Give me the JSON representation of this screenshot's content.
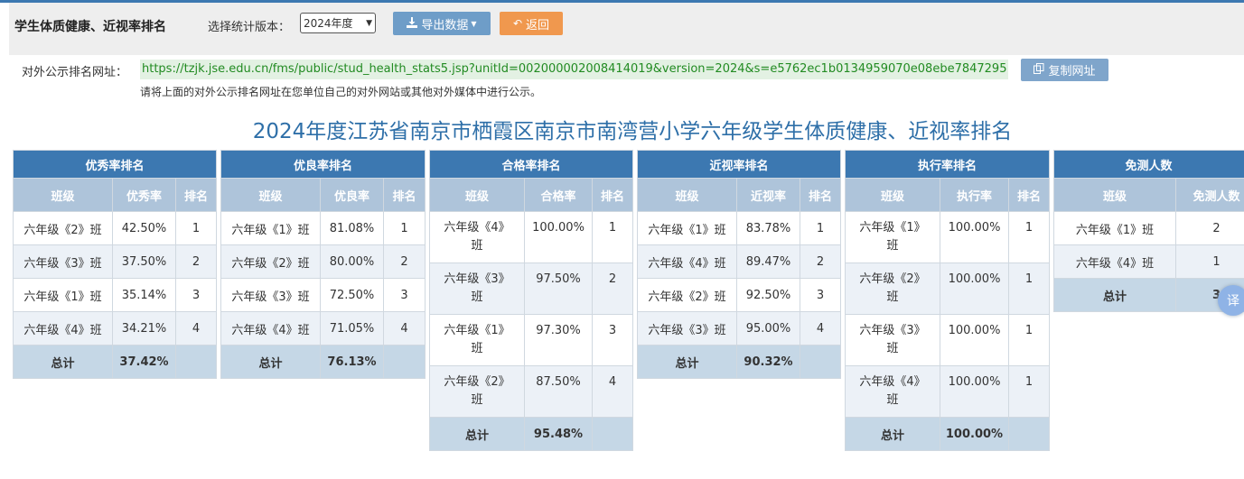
{
  "header": {
    "title": "学生体质健康、近视率排名",
    "version_label": "选择统计版本：",
    "version_selected": "2024年度",
    "export_label": "导出数据",
    "back_label": "返回"
  },
  "url_section": {
    "label": "对外公示排名网址：",
    "url": "https://tzjk.jse.edu.cn/fms/public/stud_health_stats5.jsp?unitId=002000002008414019&version=2024&s=e5762ec1b0134959070e08ebe7847295",
    "copy_label": "复制网址",
    "hint": "请将上面的对外公示排名网址在您单位自己的对外网站或其他对外媒体中进行公示。"
  },
  "main_title": "2024年度江苏省南京市栖霞区南京市南湾营小学六年级学生体质健康、近视率排名",
  "tables": {
    "excellent": {
      "title": "优秀率排名",
      "col_class": "班级",
      "col_rate": "优秀率",
      "col_rank": "排名",
      "rows": [
        {
          "cls": "六年级《2》班",
          "rate": "42.50%",
          "rank": "1"
        },
        {
          "cls": "六年级《3》班",
          "rate": "37.50%",
          "rank": "2"
        },
        {
          "cls": "六年级《1》班",
          "rate": "35.14%",
          "rank": "3"
        },
        {
          "cls": "六年级《4》班",
          "rate": "34.21%",
          "rank": "4"
        }
      ],
      "total_label": "总计",
      "total_value": "37.42%"
    },
    "good": {
      "title": "优良率排名",
      "col_class": "班级",
      "col_rate": "优良率",
      "col_rank": "排名",
      "rows": [
        {
          "cls": "六年级《1》班",
          "rate": "81.08%",
          "rank": "1"
        },
        {
          "cls": "六年级《2》班",
          "rate": "80.00%",
          "rank": "2"
        },
        {
          "cls": "六年级《3》班",
          "rate": "72.50%",
          "rank": "3"
        },
        {
          "cls": "六年级《4》班",
          "rate": "71.05%",
          "rank": "4"
        }
      ],
      "total_label": "总计",
      "total_value": "76.13%"
    },
    "pass": {
      "title": "合格率排名",
      "col_class": "班级",
      "col_rate": "合格率",
      "col_rank": "排名",
      "rows": [
        {
          "cls": "六年级《4》班",
          "rate": "100.00%",
          "rank": "1"
        },
        {
          "cls": "六年级《3》班",
          "rate": "97.50%",
          "rank": "2"
        },
        {
          "cls": "六年级《1》班",
          "rate": "97.30%",
          "rank": "3"
        },
        {
          "cls": "六年级《2》班",
          "rate": "87.50%",
          "rank": "4"
        }
      ],
      "total_label": "总计",
      "total_value": "95.48%"
    },
    "myopia": {
      "title": "近视率排名",
      "col_class": "班级",
      "col_rate": "近视率",
      "col_rank": "排名",
      "rows": [
        {
          "cls": "六年级《1》班",
          "rate": "83.78%",
          "rank": "1"
        },
        {
          "cls": "六年级《4》班",
          "rate": "89.47%",
          "rank": "2"
        },
        {
          "cls": "六年级《2》班",
          "rate": "92.50%",
          "rank": "3"
        },
        {
          "cls": "六年级《3》班",
          "rate": "95.00%",
          "rank": "4"
        }
      ],
      "total_label": "总计",
      "total_value": "90.32%"
    },
    "execution": {
      "title": "执行率排名",
      "col_class": "班级",
      "col_rate": "执行率",
      "col_rank": "排名",
      "rows": [
        {
          "cls": "六年级《1》班",
          "rate": "100.00%",
          "rank": "1"
        },
        {
          "cls": "六年级《2》班",
          "rate": "100.00%",
          "rank": "1"
        },
        {
          "cls": "六年级《3》班",
          "rate": "100.00%",
          "rank": "1"
        },
        {
          "cls": "六年级《4》班",
          "rate": "100.00%",
          "rank": "1"
        }
      ],
      "total_label": "总计",
      "total_value": "100.00%"
    },
    "exempt": {
      "title": "免测人数",
      "col_class": "班级",
      "col_count": "免测人数",
      "rows": [
        {
          "cls": "六年级《1》班",
          "count": "2"
        },
        {
          "cls": "六年级《4》班",
          "count": "1"
        }
      ],
      "total_label": "总计",
      "total_value": "3"
    }
  },
  "translate_badge": "译",
  "colors": {
    "header_blue": "#3c78b1",
    "subheader_blue": "#aec4da",
    "total_row": "#c5d7e6",
    "title_blue": "#2e6fa8",
    "back_orange": "#f0984e"
  }
}
